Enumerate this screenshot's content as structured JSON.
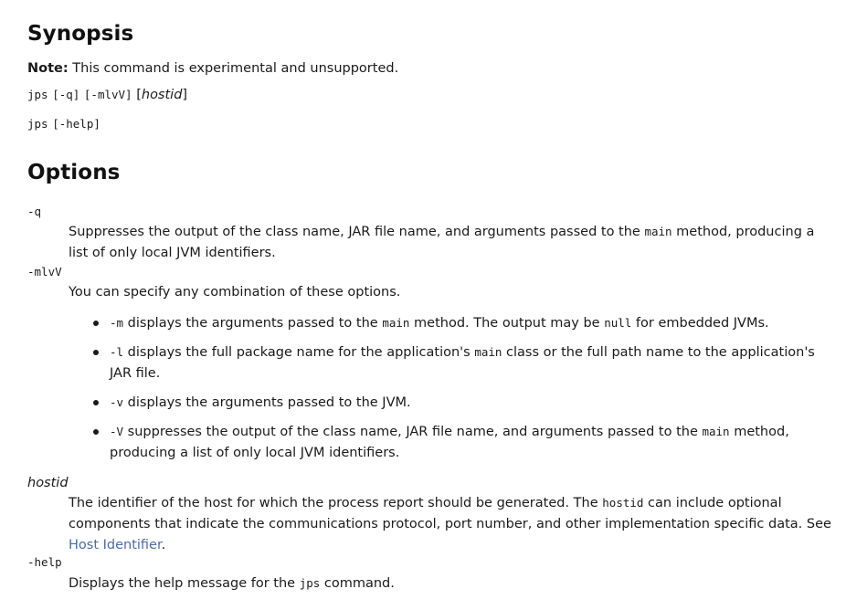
{
  "synopsis": {
    "title": "Synopsis",
    "note_label": "Note:",
    "note_text": " This command is experimental and unsupported.",
    "usage1_cmd": "jps",
    "usage1_q": "[-q]",
    "usage1_opts": "[-mlvV]",
    "usage1_host_open": "[",
    "usage1_host": "hostid",
    "usage1_host_close": "]",
    "usage2_cmd": "jps",
    "usage2_help": "[-help]"
  },
  "options": {
    "title": "Options",
    "q": {
      "term": "-q",
      "desc_a": "Suppresses the output of the class name, JAR file name, and arguments passed to the ",
      "desc_code": "main",
      "desc_b": " method, producing a list of only local JVM identifiers."
    },
    "mlvV": {
      "term": "-mlvV",
      "desc": "You can specify any combination of these options.",
      "bullets": [
        {
          "code": "-m",
          "text_a": " displays the arguments passed to the ",
          "code2": "main",
          "text_b": " method. The output may be ",
          "code3": "null",
          "text_c": " for embedded JVMs."
        },
        {
          "code": "-l",
          "text_a": " displays the full package name for the application's ",
          "code2": "main",
          "text_b": " class or the full path name to the application's JAR file.",
          "code3": "",
          "text_c": ""
        },
        {
          "code": "-v",
          "text_a": " displays the arguments passed to the JVM.",
          "code2": "",
          "text_b": "",
          "code3": "",
          "text_c": ""
        },
        {
          "code": "-V",
          "text_a": " suppresses the output of the class name, JAR file name, and arguments passed to the ",
          "code2": "main",
          "text_b": " method, producing a list of only local JVM identifiers.",
          "code3": "",
          "text_c": ""
        }
      ]
    },
    "hostid": {
      "term": "hostid",
      "desc_a": "The identifier of the host for which the process report should be generated. The ",
      "desc_code": "hostid",
      "desc_b": " can include optional components that indicate the communications protocol, port number, and other implementation specific data. See ",
      "link": "Host Identifier",
      "desc_c": "."
    },
    "help": {
      "term": "-help",
      "desc_a": "Displays the help message for the ",
      "desc_code": "jps",
      "desc_b": " command."
    }
  },
  "colors": {
    "text": "#1a1a1a",
    "link": "#4a6da7"
  }
}
